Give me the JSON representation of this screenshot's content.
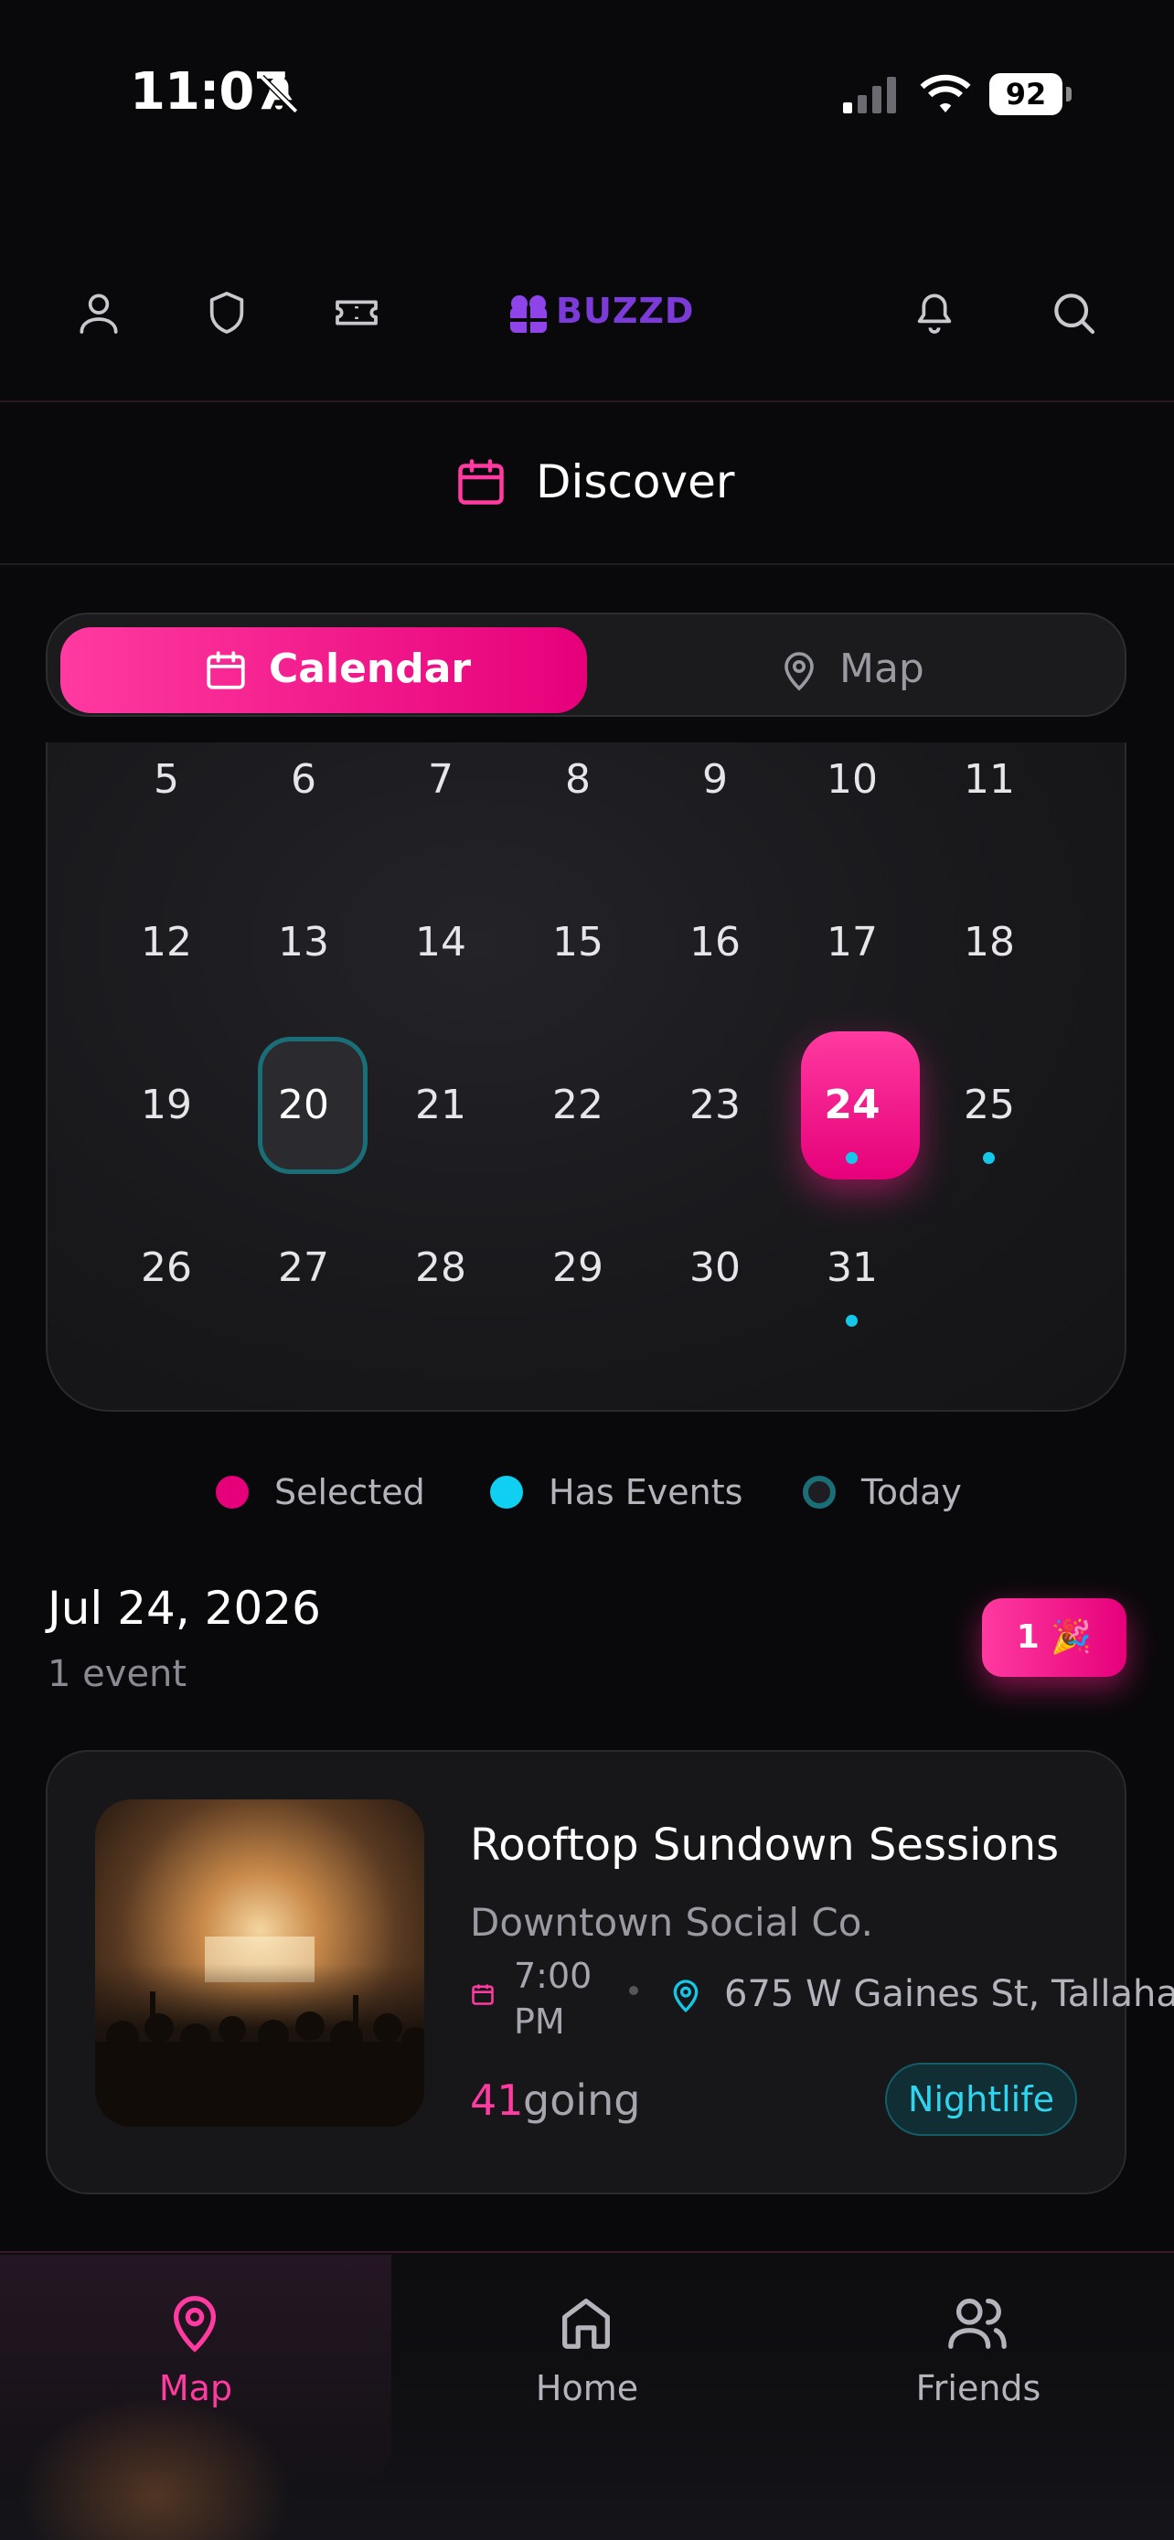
{
  "status_bar": {
    "time": "11:07",
    "battery": "92"
  },
  "header": {
    "logo_text": "BUZZD"
  },
  "page": {
    "title": "Discover"
  },
  "view_toggle": {
    "calendar_label": "Calendar",
    "map_label": "Map",
    "active": "Calendar"
  },
  "calendar": {
    "weeks": [
      [
        "5",
        "6",
        "7",
        "8",
        "9",
        "10",
        "11"
      ],
      [
        "12",
        "13",
        "14",
        "15",
        "16",
        "17",
        "18"
      ],
      [
        "19",
        "20",
        "21",
        "22",
        "23",
        "24",
        "25"
      ],
      [
        "26",
        "27",
        "28",
        "29",
        "30",
        "31"
      ]
    ],
    "today": "20",
    "selected": "24",
    "days_with_events": [
      "24",
      "25",
      "31"
    ]
  },
  "legend": {
    "selected": "Selected",
    "has_events": "Has Events",
    "today": "Today"
  },
  "selected_date": {
    "title": "Jul 24, 2026",
    "subtitle": "1 event",
    "badge": "1 🎉"
  },
  "event": {
    "title": "Rooftop Sundown Sessions",
    "venue": "Downtown Social Co.",
    "time": "7:00 PM",
    "address": "675 W Gaines St, Tallaha",
    "going_count": "41",
    "going_label": "going",
    "tag": "Nightlife"
  },
  "tab_bar": {
    "map": "Map",
    "home": "Home",
    "friends": "Friends",
    "active": "Map"
  },
  "colors": {
    "accent": "#ff3aa0",
    "event_dot": "#15c8ea",
    "today_ring": "#1a6e78",
    "background": "#09090b"
  }
}
